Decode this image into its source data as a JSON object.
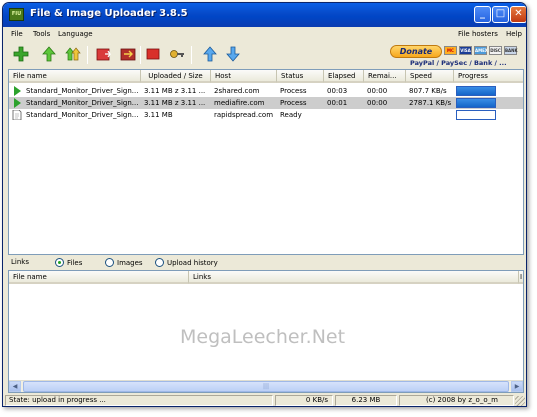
{
  "window": {
    "title": "File & Image Uploader 3.8.5",
    "app_icon_text": "FIU",
    "controls": {
      "minimize": "_",
      "maximize": "□",
      "close": "✕"
    }
  },
  "menu": {
    "left": [
      "File",
      "Tools",
      "Language"
    ],
    "right": [
      "File hosters",
      "Help"
    ]
  },
  "toolbar": {
    "icons": [
      "add-icon",
      "upload-icon",
      "upload-all-icon",
      "delete-icon",
      "clear-icon",
      "stop-icon",
      "key-icon",
      "move-up-icon",
      "move-down-icon"
    ],
    "donate": {
      "label": "Donate",
      "cards": [
        "MC",
        "VISA",
        "AMEX",
        "DISC",
        "BANK"
      ],
      "caption": "PayPal / PaySec / Bank / ..."
    }
  },
  "upload_table": {
    "columns": [
      "File name",
      "Uploaded / Size",
      "Host",
      "Status",
      "Elapsed",
      "Remai...",
      "Speed",
      "Progress"
    ],
    "rows": [
      {
        "icon": "play-icon",
        "file": "Standard_Monitor_Driver_Sign...",
        "uploaded": "3.11 MB z 3.11 ...",
        "host": "2shared.com",
        "status": "Process",
        "elapsed": "00:03",
        "remaining": "00:00",
        "speed": "807.7 KB/s",
        "progress": 1.0,
        "selected": false
      },
      {
        "icon": "play-icon",
        "file": "Standard_Monitor_Driver_Sign...",
        "uploaded": "3.11 MB z 3.11 ...",
        "host": "mediafire.com",
        "status": "Process",
        "elapsed": "00:01",
        "remaining": "00:00",
        "speed": "2787.1 KB/s",
        "progress": 1.0,
        "selected": true
      },
      {
        "icon": "file-icon",
        "file": "Standard_Monitor_Driver_Sign...",
        "uploaded": "3.11 MB",
        "host": "rapidspread.com",
        "status": "Ready",
        "elapsed": "",
        "remaining": "",
        "speed": "",
        "progress": 0.0,
        "selected": false
      }
    ]
  },
  "links_panel": {
    "label": "Links",
    "options": [
      "Files",
      "Images",
      "Upload history"
    ],
    "selected": "Files",
    "columns": [
      "File name",
      "Links",
      "I"
    ]
  },
  "watermark": "MegaLeecher.Net",
  "status_bar": {
    "state": "State: upload in progress ...",
    "speed": "0 KB/s",
    "total": "6.23 MB",
    "copyright": "(c) 2008 by z_o_o_m"
  },
  "colors": {
    "titlebar": "#0a5fe6",
    "progress": "#1565c8",
    "selected_row": "#cdcdcd",
    "window_bg": "#ece9d8"
  }
}
